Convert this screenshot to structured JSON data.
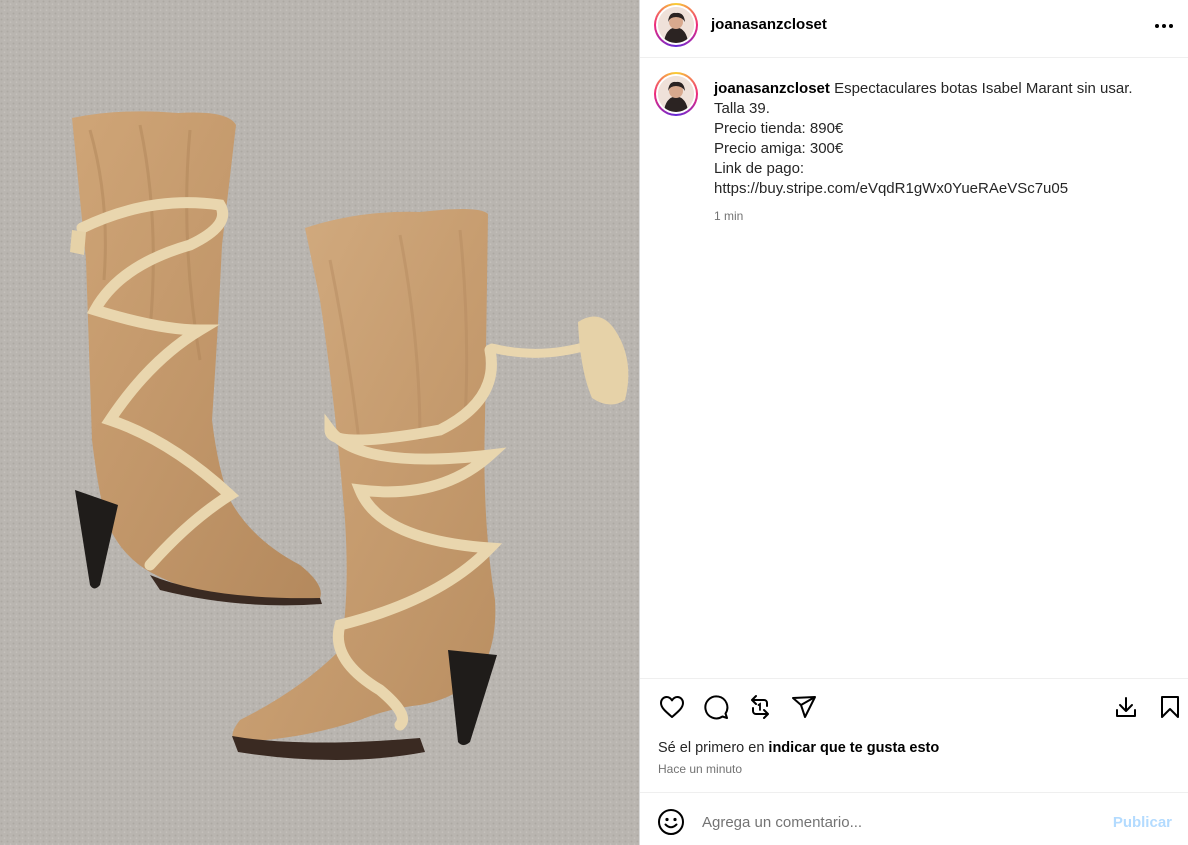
{
  "post": {
    "username": "joanasanzcloset",
    "image_alt": "Botas Isabel Marant de ante camel con cordón",
    "caption": {
      "username": "joanasanzcloset",
      "lines": [
        "Espectaculares botas Isabel Marant sin usar.",
        "Talla 39.",
        "Precio tienda: 890€",
        "Precio amiga: 300€",
        "Link de pago:",
        "https://buy.stripe.com/eVqdR1gWx0YueRAeVSc7u05"
      ],
      "time": "1 min"
    },
    "likes_text_prefix": "Sé el primero en ",
    "likes_text_bold": "indicar que te gusta esto",
    "post_time": "Hace un minuto"
  },
  "comment": {
    "placeholder": "Agrega un comentario...",
    "publish_label": "Publicar"
  },
  "icons": {
    "more": "more-horizontal-icon",
    "like": "heart-icon",
    "comment": "comment-bubble-icon",
    "repost": "repost-icon",
    "share": "paper-plane-icon",
    "download": "download-icon",
    "save": "bookmark-icon",
    "emoji": "smiley-icon"
  },
  "colors": {
    "publish_disabled": "#b3dbff",
    "secondary_text": "#737373",
    "boot_suede": "#c59a6a",
    "rope": "#e9d6ae",
    "carpet": "#b8b4af"
  }
}
